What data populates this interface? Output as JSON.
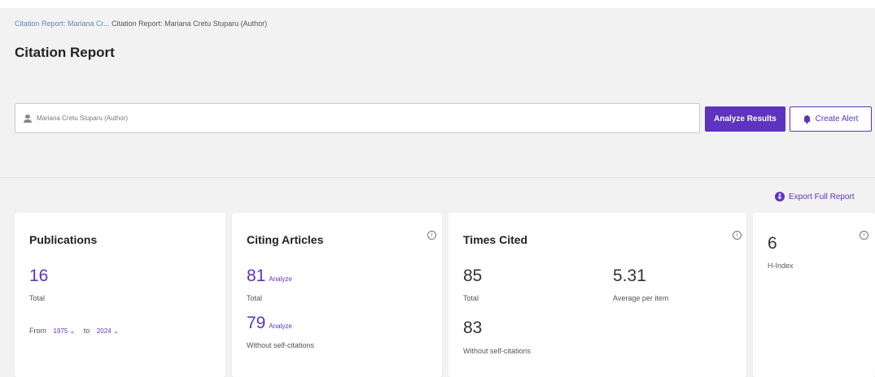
{
  "breadcrumb": {
    "link": "Citation Report: Mariana Cr...",
    "current": "Citation Report: Mariana Cretu Stuparu (Author)"
  },
  "page_title": "Citation Report",
  "query": {
    "text": "Mariana Cretu Stuparu (Author)"
  },
  "buttons": {
    "analyze": "Analyze Results",
    "alert": "Create Alert"
  },
  "export": {
    "label": "Export Full Report"
  },
  "cards": {
    "publications": {
      "title": "Publications",
      "total": "16",
      "total_label": "Total",
      "from_label": "From",
      "from_year": "1975 ⌄",
      "to_label": "to",
      "to_year": "2024 ⌄"
    },
    "citing": {
      "title": "Citing Articles",
      "total": "81",
      "analyze": "Analyze",
      "total_label": "Total",
      "without": "79",
      "analyze2": "Analyze",
      "without_label": "Without self-citations"
    },
    "times_cited": {
      "title": "Times Cited",
      "total": "85",
      "total_label": "Total",
      "avg": "5.31",
      "avg_label": "Average per item",
      "without": "83",
      "without_label": "Without self-citations"
    },
    "hindex": {
      "value": "6",
      "label": "H-Index"
    }
  },
  "colors": {
    "accent": "#5e33bf",
    "background": "#f2f2f3"
  },
  "icons": {
    "info": "info-icon",
    "bell": "bell-icon",
    "person": "person-icon",
    "export": "export-icon"
  }
}
